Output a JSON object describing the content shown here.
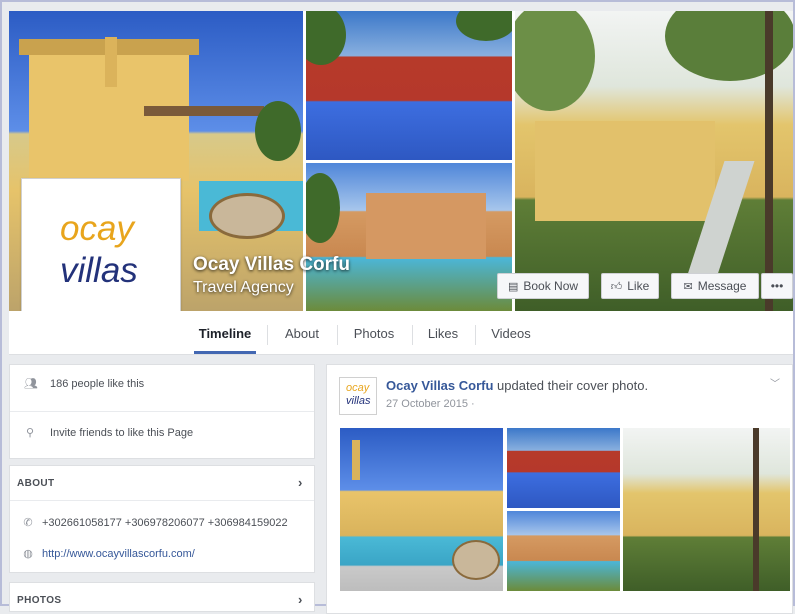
{
  "page": {
    "name": "Ocay Villas Corfu",
    "category": "Travel Agency",
    "logo_line1": "ocay",
    "logo_line2": "villas"
  },
  "cover_actions": {
    "book_now": "Book Now",
    "like": "Like",
    "message": "Message",
    "more": "•••"
  },
  "tabs": [
    "Timeline",
    "About",
    "Photos",
    "Likes",
    "Videos"
  ],
  "sidebar": {
    "likes_text": "186 people like this",
    "invite_text": "Invite friends to like this Page",
    "about_heading": "ABOUT",
    "phones": "+302661058177 +306978206077 +306984159022",
    "website": "http://www.ocayvillascorfu.com/",
    "photos_heading": "PHOTOS"
  },
  "post": {
    "author": "Ocay Villas Corfu",
    "action": "updated their cover photo.",
    "date": "27 October 2015",
    "privacy_glyph": "·"
  },
  "colors": {
    "accent": "#4267b2",
    "logo_orange": "#e8a51d",
    "logo_navy": "#23327a",
    "link": "#365899"
  }
}
